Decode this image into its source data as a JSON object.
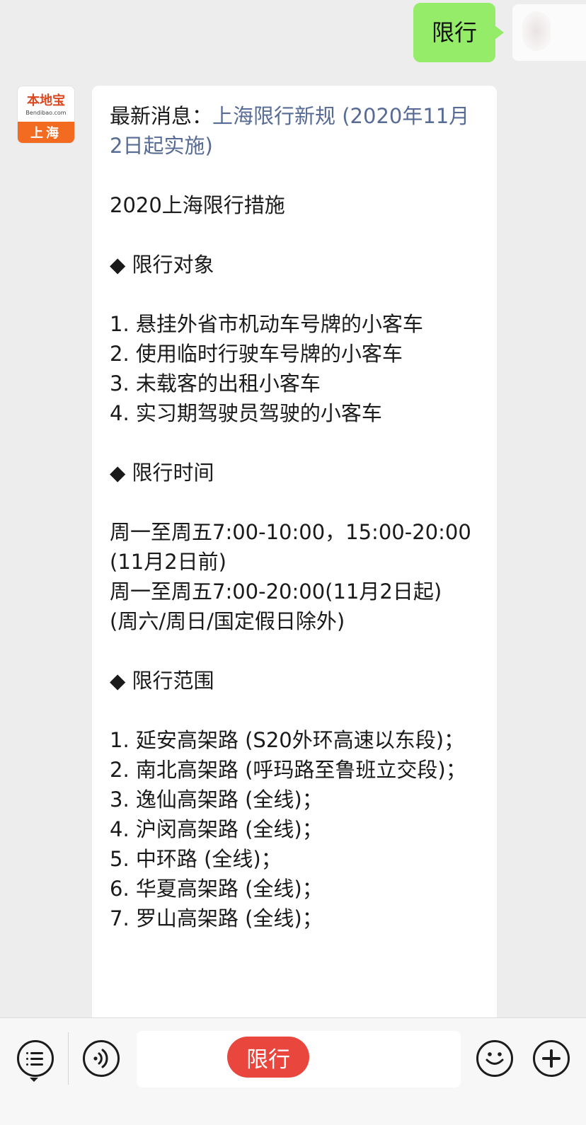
{
  "sent_message": {
    "text": "限行"
  },
  "bot_avatar": {
    "logo_main": "本地宝",
    "logo_sub": "Bendibao.com",
    "logo_city": "上海"
  },
  "reply": {
    "latest_prefix": "最新消息：",
    "latest_link": "上海限行新规 (2020年11月2日起实施)",
    "title": "2020上海限行措施",
    "section_targets": "◆ 限行对象",
    "targets": [
      "1. 悬挂外省市机动车号牌的小客车",
      "2. 使用临时行驶车号牌的小客车",
      "3. 未载客的出租小客车",
      "4. 实习期驾驶员驾驶的小客车"
    ],
    "section_time": "◆ 限行时间",
    "time_lines": [
      "周一至周五7:00-10:00，15:00-20:00(11月2日前)",
      "周一至周五7:00-20:00(11月2日起)",
      "(周六/周日/国定假日除外)"
    ],
    "section_scope": "◆ 限行范围",
    "scope": [
      "1. 延安高架路 (S20外环高速以东段)；",
      "2. 南北高架路 (呼玛路至鲁班立交段)；",
      "3. 逸仙高架路 (全线)；",
      "4. 沪闵高架路 (全线)；",
      "5. 中环路 (全线)；",
      "6. 华夏高架路 (全线)；",
      "7. 罗山高架路 (全线)；"
    ]
  },
  "input_bar": {
    "chip_text": "限行",
    "icons": {
      "menu": "list-menu-icon",
      "voice": "voice-icon",
      "emoji": "emoji-icon",
      "plus": "plus-icon"
    }
  },
  "colors": {
    "sent_bubble": "#95ec69",
    "link": "#576b95",
    "chip": "#e9473d",
    "logo_orange": "#f26b20"
  }
}
